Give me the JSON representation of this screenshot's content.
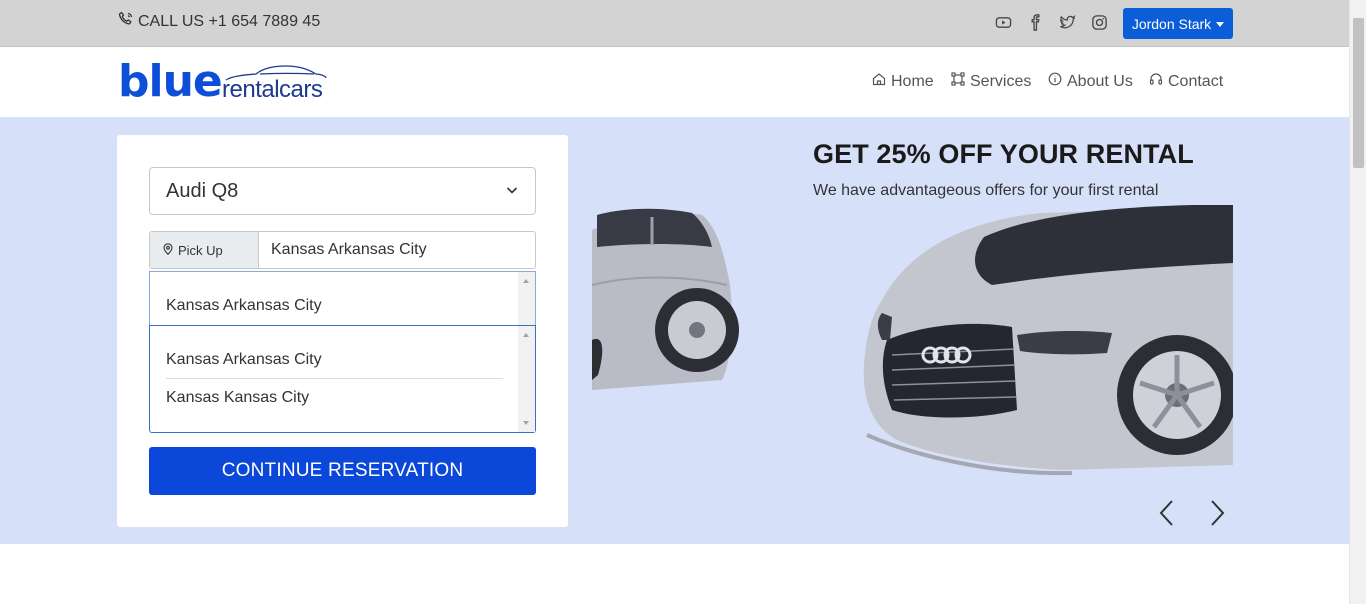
{
  "topbar": {
    "call_label": "CALL US +1 654 7889 45",
    "social_icons": [
      "youtube-icon",
      "facebook-icon",
      "twitter-icon",
      "instagram-icon"
    ],
    "user_button": "Jordon Stark",
    "background": "#d3d3d3",
    "accent": "#0b5ed7"
  },
  "logo": {
    "primary": "blue",
    "secondary": "rentalcars"
  },
  "nav": {
    "items": [
      {
        "label": "Home",
        "icon": "home-icon"
      },
      {
        "label": "Services",
        "icon": "services-icon"
      },
      {
        "label": "About Us",
        "icon": "info-icon"
      },
      {
        "label": "Contact",
        "icon": "headset-icon"
      }
    ]
  },
  "form": {
    "car_select_value": "Audi Q8",
    "pickup_label": "Pick Up",
    "pickup_value": "Kansas Arkansas City",
    "suggestions_primary": [
      "Kansas Arkansas City"
    ],
    "suggestions_secondary": [
      "Kansas Arkansas City",
      "Kansas Kansas City"
    ],
    "continue_label": "CONTINUE RESERVATION",
    "button_color": "#0b47d9"
  },
  "promo": {
    "title": "GET 25% OFF YOUR RENTAL",
    "subtitle": "We have advantageous offers for your first rental",
    "hero_background": "#d6e0f9"
  }
}
